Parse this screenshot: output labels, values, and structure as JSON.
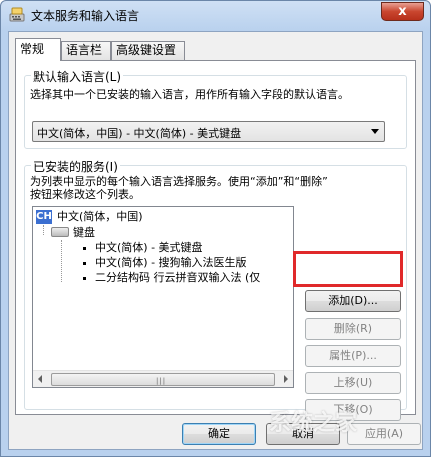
{
  "window": {
    "title": "文本服务和输入语言",
    "close_label": "x"
  },
  "tabs": [
    {
      "label": "常规",
      "active": true
    },
    {
      "label": "语言栏",
      "active": false
    },
    {
      "label": "高级键设置",
      "active": false
    }
  ],
  "default_language": {
    "legend": "默认输入语言(L)",
    "description": "选择其中一个已安装的输入语言，用作所有输入字段的默认语言。",
    "selected": "中文(简体，中国) - 中文(简体) - 美式键盘"
  },
  "installed_services": {
    "legend": "已安装的服务(I)",
    "description_line1": "为列表中显示的每个输入语言选择服务。使用“添加”和“删除”",
    "description_line2": "按钮来修改这个列表。",
    "tree": {
      "language_badge": "CH",
      "language": "中文(简体，中国)",
      "category": "键盘",
      "items": [
        "中文(简体) - 美式键盘",
        "中文(简体) - 搜狗输入法医生版",
        "二分结构码 行云拼音双输入法 (仅"
      ],
      "scroll_grip": "|||"
    }
  },
  "buttons": {
    "add": "添加(D)...",
    "remove": "删除(R)",
    "properties": "属性(P)...",
    "move_up": "上移(U)",
    "move_down": "下移(O)",
    "ok": "确定",
    "cancel": "取消",
    "apply": "应用(A)"
  },
  "watermark": "系统之家",
  "colors": {
    "highlight": "#e0292a",
    "badge": "#3b6fd1"
  }
}
